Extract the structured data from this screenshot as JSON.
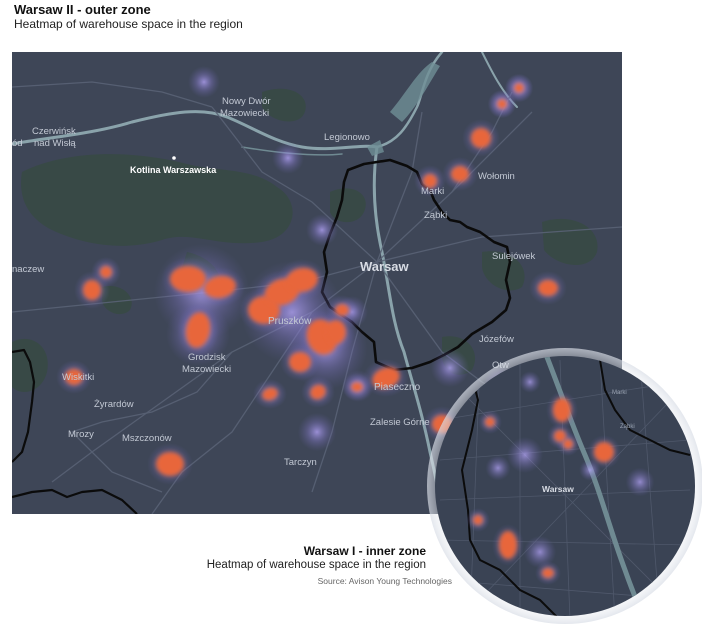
{
  "outer": {
    "title": "Warsaw II - outer zone",
    "subtitle": "Heatmap of warehouse space in the region"
  },
  "inner": {
    "title": "Warsaw I - inner zone",
    "subtitle": "Heatmap of warehouse space in the region"
  },
  "source": "Source: Avison Young Technologies",
  "colors": {
    "map_bg": "#3e4657",
    "forest": "#3a4c47",
    "river": "#7f9aa3",
    "heat": "#e8663a",
    "glow": "#9b8ee0",
    "border": "#0b0b0b"
  },
  "outer_labels": [
    {
      "id": "nowy-dwor-1",
      "text": "Nowy Dwór"
    },
    {
      "id": "nowy-dwor-2",
      "text": "Mazowiecki"
    },
    {
      "id": "czerwinsk-1",
      "text": "Czerwińsk"
    },
    {
      "id": "czerwinsk-2",
      "text": "nad Wisłą"
    },
    {
      "id": "od",
      "text": "ód"
    },
    {
      "id": "legionowo",
      "text": "Legionowo"
    },
    {
      "id": "kotlina",
      "text": "Kotlina Warszawska"
    },
    {
      "id": "marki",
      "text": "Marki"
    },
    {
      "id": "wolomin",
      "text": "Wołomin"
    },
    {
      "id": "zabki",
      "text": "Ząbki"
    },
    {
      "id": "warsaw",
      "text": "Warsaw"
    },
    {
      "id": "sulejowek",
      "text": "Sulejówek"
    },
    {
      "id": "naczew",
      "text": "naczew"
    },
    {
      "id": "pruszkow",
      "text": "Pruszków"
    },
    {
      "id": "jozefow",
      "text": "Józefów"
    },
    {
      "id": "otw",
      "text": "Otw"
    },
    {
      "id": "grodzisk-1",
      "text": "Grodzisk"
    },
    {
      "id": "grodzisk-2",
      "text": "Mazowiecki"
    },
    {
      "id": "wiskitki",
      "text": "Wiskitki"
    },
    {
      "id": "piaseczno",
      "text": "Piaseczno"
    },
    {
      "id": "zyrardow",
      "text": "Żyrardów"
    },
    {
      "id": "zalesie",
      "text": "Zalesie Górne"
    },
    {
      "id": "mrozy",
      "text": "Mrozy"
    },
    {
      "id": "tarczyn",
      "text": "Tarczyn"
    },
    {
      "id": "mszczonow",
      "text": "Mszczonów"
    }
  ],
  "inner_labels": [
    {
      "id": "i-warsaw",
      "text": "Warsaw"
    },
    {
      "id": "i-marki",
      "text": "Marki"
    },
    {
      "id": "i-zabki",
      "text": "Ząbki"
    }
  ]
}
